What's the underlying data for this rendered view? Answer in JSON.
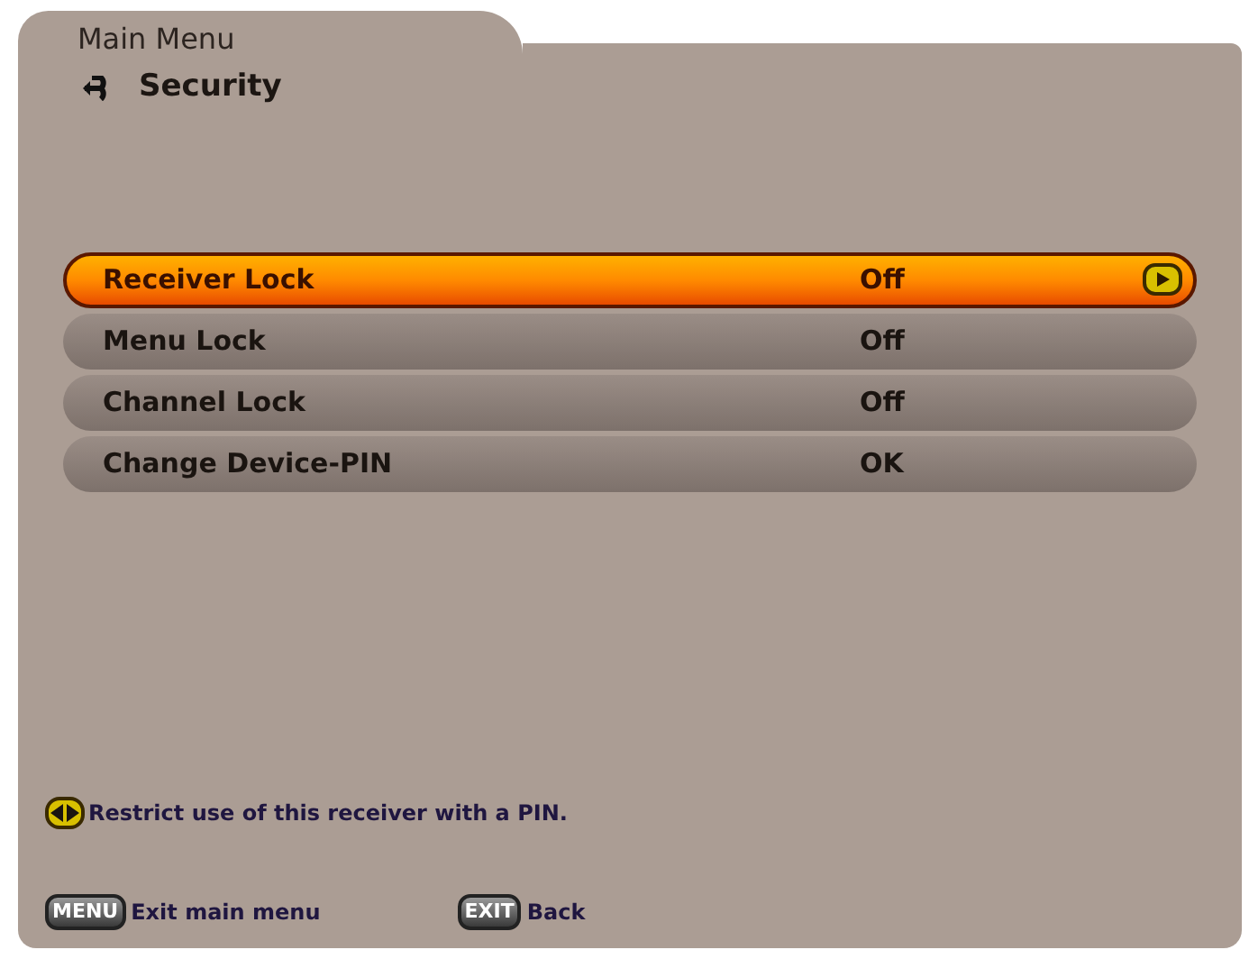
{
  "header": {
    "title": "Main Menu",
    "subtitle": "Security"
  },
  "items": [
    {
      "label": "Receiver Lock",
      "value": "Off",
      "selected": true
    },
    {
      "label": "Menu Lock",
      "value": "Off",
      "selected": false
    },
    {
      "label": "Channel Lock",
      "value": "Off",
      "selected": false
    },
    {
      "label": "Change Device-PIN",
      "value": "OK",
      "selected": false
    }
  ],
  "hint": "Restrict use of this receiver with a PIN.",
  "footer": [
    {
      "key": "MENU",
      "label": "Exit main menu"
    },
    {
      "key": "EXIT",
      "label": "Back"
    }
  ]
}
